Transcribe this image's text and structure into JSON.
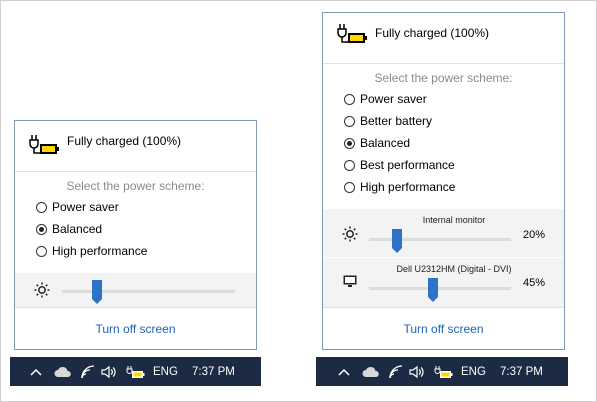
{
  "left": {
    "status": "Fully charged (100%)",
    "scheme_label": "Select the power scheme:",
    "schemes": [
      {
        "label": "Power saver",
        "checked": false
      },
      {
        "label": "Balanced",
        "checked": true
      },
      {
        "label": "High performance",
        "checked": false
      }
    ],
    "brightness_level": 0.2,
    "link": "Turn off screen"
  },
  "right": {
    "status": "Fully charged (100%)",
    "scheme_label": "Select the power scheme:",
    "schemes": [
      {
        "label": "Power saver",
        "checked": false
      },
      {
        "label": "Better battery",
        "checked": false
      },
      {
        "label": "Balanced",
        "checked": true
      },
      {
        "label": "Best performance",
        "checked": false
      },
      {
        "label": "High performance",
        "checked": false
      }
    ],
    "monitors": [
      {
        "name": "Internal monitor",
        "percent": "20%",
        "level": 0.2
      },
      {
        "name": "Dell U2312HM (Digital - DVI)",
        "percent": "45%",
        "level": 0.45
      }
    ],
    "link": "Turn off screen"
  },
  "taskbar": {
    "language": "ENG",
    "time": "7:37 PM"
  },
  "icons": {
    "battery": "battery-plug-icon",
    "brightness": "sun-icon",
    "monitor": "monitor-icon",
    "chevron": "chevron-up-icon",
    "cloud": "cloud-icon",
    "wifi": "wifi-icon",
    "volume": "volume-icon"
  },
  "colors": {
    "accent": "#2f73c8",
    "link": "#1f63b5",
    "taskbar": "#1d2a43",
    "battery_fill": "#ffd800",
    "flyout_border": "#7f98b4"
  }
}
